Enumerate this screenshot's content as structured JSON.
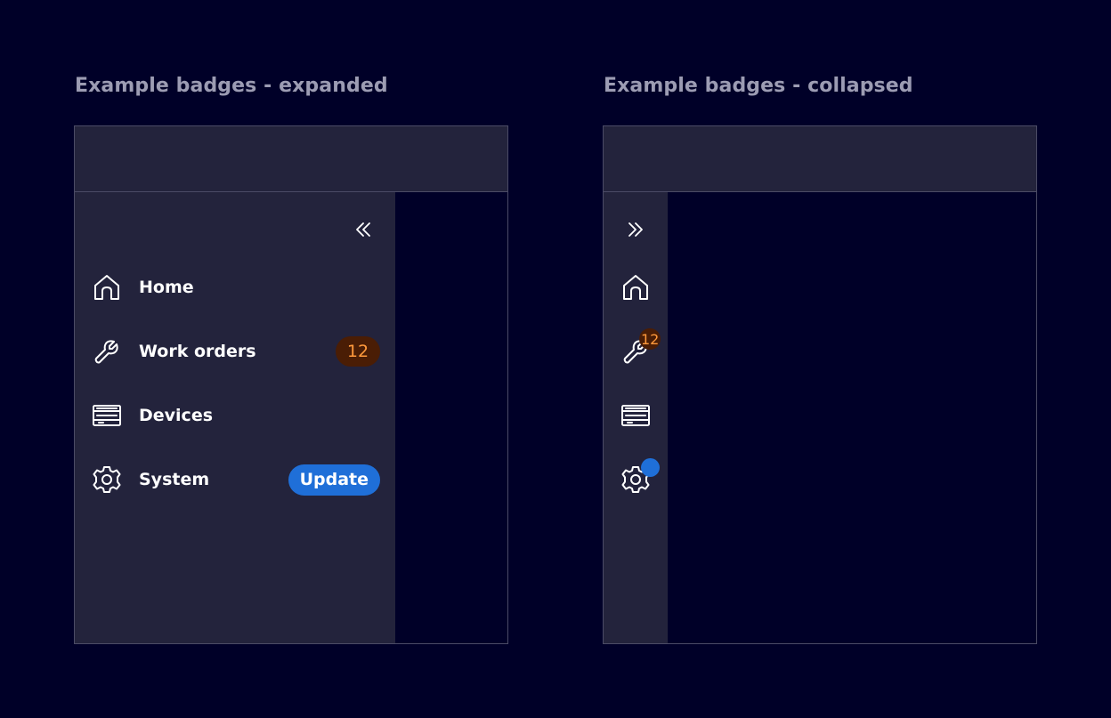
{
  "expanded": {
    "title": "Example badges - expanded",
    "toggle_icon": "double-chevron-left-icon",
    "items": [
      {
        "label": "Home",
        "icon": "home-icon"
      },
      {
        "label": "Work orders",
        "icon": "wrench-icon",
        "badge": "12"
      },
      {
        "label": "Devices",
        "icon": "devices-icon"
      },
      {
        "label": "System",
        "icon": "gear-icon",
        "badge": "Update"
      }
    ]
  },
  "collapsed": {
    "title": "Example badges - collapsed",
    "toggle_icon": "double-chevron-right-icon",
    "items": [
      {
        "icon": "home-icon"
      },
      {
        "icon": "wrench-icon",
        "badge": "12"
      },
      {
        "icon": "devices-icon"
      },
      {
        "icon": "gear-icon",
        "badge": "dot"
      }
    ]
  },
  "colors": {
    "background": "#000028",
    "panel": "#23233c",
    "border": "#4b4b66",
    "count_badge_bg": "#4a1d05",
    "count_badge_text": "#ff9a3d",
    "info_badge": "#1f6fd8"
  }
}
